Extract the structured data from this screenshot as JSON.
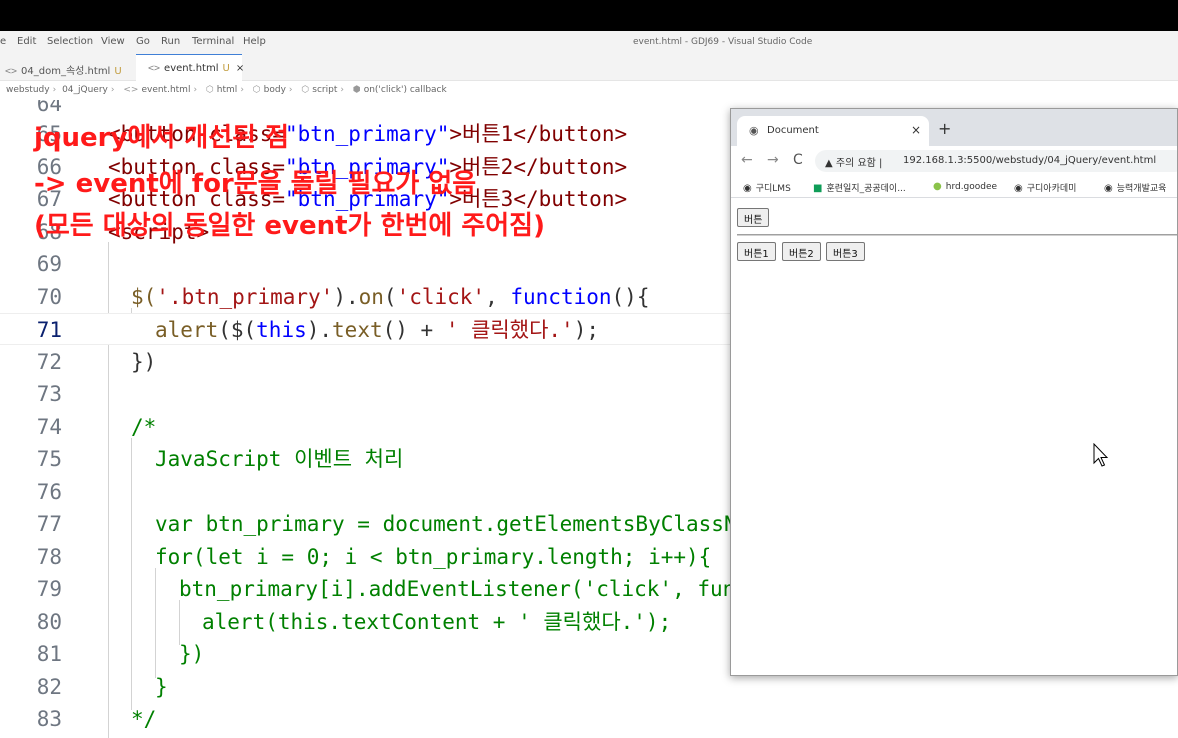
{
  "menubar": {
    "items": [
      "e",
      "Edit",
      "Selection",
      "View",
      "Go",
      "Run",
      "Terminal",
      "Help"
    ],
    "window_title": "event.html - GDJ69 - Visual Studio Code"
  },
  "tabs": [
    {
      "icon": "<>",
      "label": "04_dom_속성.html",
      "badge": "U"
    },
    {
      "icon": "<>",
      "label": "event.html",
      "badge": "U",
      "close": "×"
    }
  ],
  "breadcrumb": [
    "webstudy",
    "04_jQuery",
    "event.html",
    "html",
    "body",
    "script",
    "on('click') callback"
  ],
  "editor": {
    "line_numbers": [
      "64",
      "65",
      "66",
      "67",
      "68",
      "69",
      "70",
      "71",
      "72",
      "73",
      "74",
      "75",
      "76",
      "77",
      "78",
      "79",
      "80",
      "81",
      "82",
      "83"
    ],
    "lines": {
      "l65_a": "<button class=",
      "l65_b": "\"btn_primary\"",
      "l65_c": ">버튼1</button>",
      "l66_a": "<button class=",
      "l66_b": "\"btn_primary\"",
      "l66_c": ">버튼2</button>",
      "l67_a": "<button class=",
      "l67_b": "\"btn_primary\"",
      "l67_c": ">버튼3</button>",
      "l68": "<script>",
      "l70_a": "$(",
      "l70_b": "'.btn_primary'",
      "l70_c": ").",
      "l70_d": "on",
      "l70_e": "(",
      "l70_f": "'click'",
      "l70_g": ", ",
      "l70_h": "function",
      "l70_i": "(){",
      "l71_a": "alert",
      "l71_b": "($(",
      "l71_c": "this",
      "l71_d": ").",
      "l71_e": "text",
      "l71_f": "() + ",
      "l71_g": "' 클릭했다.'",
      "l71_h": ");",
      "l72": "})",
      "l74": "/*",
      "l75": "JavaScript 이벤트 처리",
      "l77": "var btn_primary = document.getElementsByClassName",
      "l78": "for(let i = 0; i < btn_primary.length; i++){",
      "l79": "btn_primary[i].addEventListener('click', functi",
      "l80": "alert(this.textContent + ' 클릭했다.');",
      "l81": "})",
      "l82": "}",
      "l83": "*/"
    },
    "current_line": "71"
  },
  "overlay": {
    "line1": "jquery에서 개선된 점",
    "line2": "-> event에 for문을 돌릴 필요가 없음",
    "line3": "(모든 대상의 동일한 event가 한번에 주어짐)",
    "color": "#ff1a1a"
  },
  "browser": {
    "tab_title": "Document",
    "tab_close": "×",
    "new_tab": "+",
    "security_label": "주의 요함",
    "url": "192.168.1.3:5500/webstudy/04_jQuery/event.html",
    "bookmarks": [
      "구디LMS",
      "훈련일지_공공데이...",
      "hrd.goodee",
      "구디아카데미",
      "능력개발교육"
    ],
    "page": {
      "top_button": "버튼",
      "buttons": [
        "버튼1",
        "버튼2",
        "버튼3"
      ]
    }
  }
}
